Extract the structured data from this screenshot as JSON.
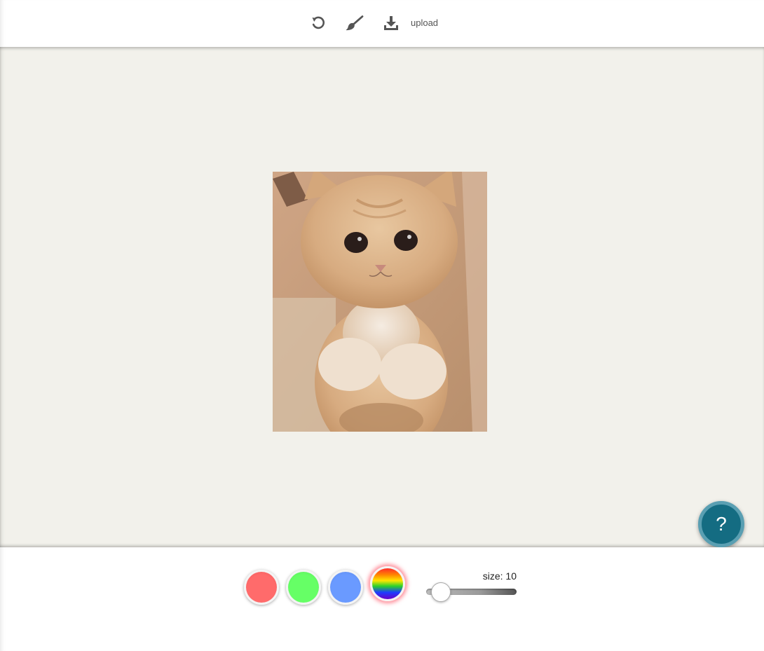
{
  "toolbar": {
    "tools": [
      {
        "name": "undo",
        "icon": "undo-icon"
      },
      {
        "name": "brush",
        "icon": "brush-icon"
      },
      {
        "name": "download",
        "icon": "download-icon"
      }
    ],
    "upload_label": "upload"
  },
  "canvas": {
    "background_color": "#f2f1eb",
    "image": {
      "subject": "kitten-photo"
    }
  },
  "help": {
    "label": "?",
    "color": "#146c82"
  },
  "palette": {
    "colors": [
      {
        "name": "red",
        "hex": "#ff6b6b"
      },
      {
        "name": "green",
        "hex": "#66ff66"
      },
      {
        "name": "blue",
        "hex": "#6a9aff"
      },
      {
        "name": "rainbow",
        "hex": "rainbow",
        "selected": true
      }
    ]
  },
  "size": {
    "label": "size: 10",
    "value": 10
  }
}
